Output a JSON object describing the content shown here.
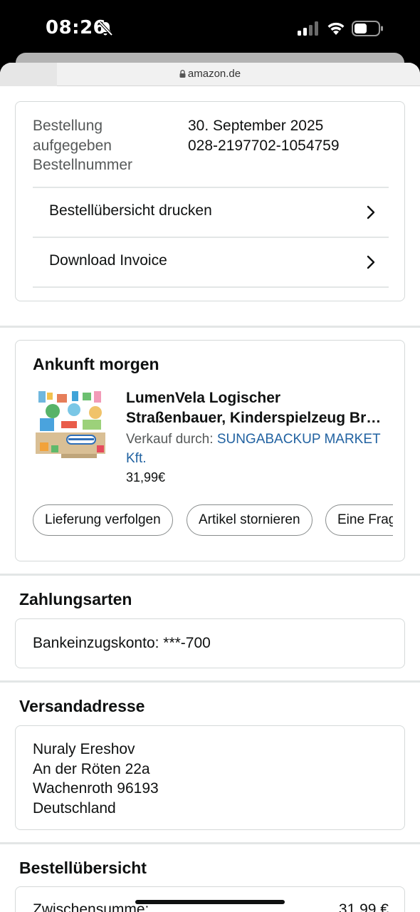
{
  "status_bar": {
    "time": "08:26"
  },
  "browser": {
    "url": "amazon.de"
  },
  "order_info": {
    "labels": [
      "Bestellung",
      "aufgegeben",
      "Bestellnummer"
    ],
    "date": "30. September 2025",
    "order_number": "028-2197702-1054759",
    "actions": [
      {
        "label": "Bestellübersicht drucken"
      },
      {
        "label": "Download Invoice"
      }
    ]
  },
  "shipment": {
    "heading": "Ankunft morgen",
    "product": {
      "title_line1": "LumenVela Logischer",
      "title_line2": "Straßenbauer, Kinderspielzeug Br…",
      "seller_prefix": "Verkauf durch:",
      "seller_name": "SUNGABACKUP MARKET",
      "seller_name_2": "Kft.",
      "price": "31,99€"
    },
    "buttons": [
      {
        "label": "Lieferung verfolgen"
      },
      {
        "label": "Artikel stornieren"
      },
      {
        "label": "Eine Frage zum Produkt stellen"
      }
    ]
  },
  "payment": {
    "heading": "Zahlungsarten",
    "method": "Bankeinzugskonto: ***-700"
  },
  "shipping_address": {
    "heading": "Versandadresse",
    "lines": [
      "Nuraly Ereshov",
      "An der Röten 22a",
      "Wachenroth 96193",
      "Deutschland"
    ]
  },
  "order_summary": {
    "heading": "Bestellübersicht",
    "subtotal_label": "Zwischensumme:",
    "subtotal_value": "31,99 €"
  }
}
